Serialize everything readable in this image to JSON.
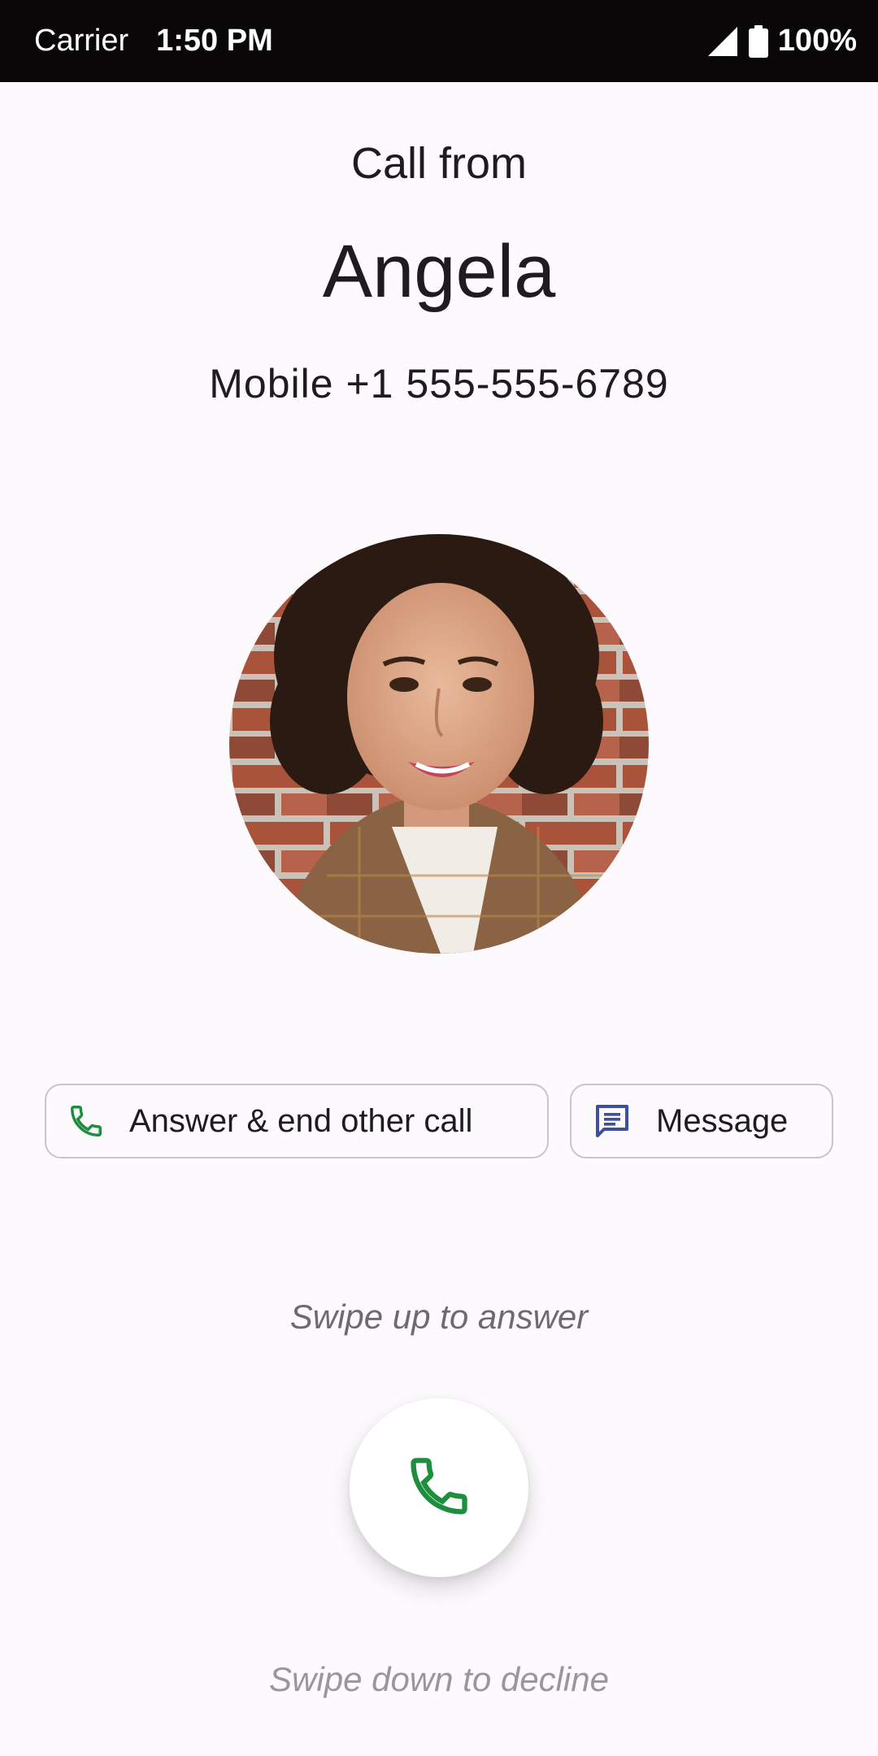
{
  "status_bar": {
    "carrier": "Carrier",
    "time": "1:50 PM",
    "battery": "100%",
    "icons": [
      "signal-icon",
      "battery-icon"
    ]
  },
  "call": {
    "header": "Call from",
    "caller_name": "Angela",
    "caller_number": "Mobile +1 555-555-6789"
  },
  "actions": {
    "answer_end_label": "Answer & end other call",
    "message_label": "Message"
  },
  "hints": {
    "swipe_up": "Swipe up to answer",
    "swipe_down": "Swipe down to decline"
  },
  "colors": {
    "accent_green": "#1e8e3e",
    "message_blue": "#3c4fa0",
    "background": "#fdfafd",
    "status_bar": "#0a0709"
  }
}
